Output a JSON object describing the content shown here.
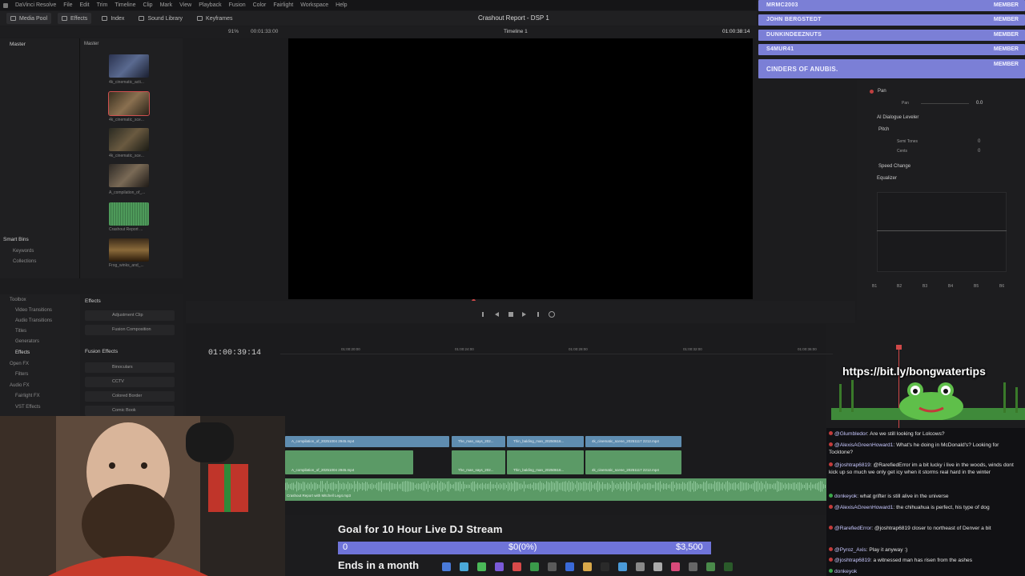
{
  "app": {
    "menu": [
      "DaVinci Resolve",
      "File",
      "Edit",
      "Trim",
      "Timeline",
      "Clip",
      "Mark",
      "View",
      "Playback",
      "Fusion",
      "Color",
      "Fairlight",
      "Workspace",
      "Help"
    ],
    "project_title": "Crashout Report - DSP 1",
    "toolbar": {
      "media_pool": "Media Pool",
      "effects": "Effects",
      "index": "Index",
      "sound_library": "Sound Library",
      "keyframes": "Keyframes"
    },
    "row2": {
      "zoom": "91%",
      "source_tc": "00:01:33:00",
      "timeline_name": "Timeline 1",
      "record_tc": "01:00:38:14"
    }
  },
  "media_pool": {
    "bin_root": "Master",
    "smart_bins_header": "Smart Bins",
    "smart_bins": [
      "Keywords",
      "Collections"
    ],
    "clips": [
      "4k_cinematic_acti...",
      "4k_cinematic_sce...",
      "4k_cinematic_sce...",
      "A_compilation_of_...",
      "Crashout Report ...",
      "Frog_winks_and_..."
    ]
  },
  "toolbox": {
    "items": [
      "Toolbox",
      "Video Transitions",
      "Audio Transitions",
      "Titles",
      "Generators",
      "Effects",
      "Open FX",
      "Filters",
      "Audio FX",
      "Fairlight FX",
      "VST Effects"
    ],
    "effects_header": "Effects",
    "effects_items": [
      "Adjustment Clip",
      "Fusion Composition"
    ],
    "fusion_header": "Fusion Effects",
    "fusion_items": [
      "Binoculars",
      "CCTV",
      "Colored Border",
      "Comic Book"
    ]
  },
  "timeline": {
    "timecode": "01:00:39:14",
    "ruler": [
      "01:00:20:00",
      "01:00:24:00",
      "01:00:28:00",
      "01:00:32:00",
      "01:00:36:00",
      "01:00:40:00"
    ],
    "video_clips": [
      "A_compilation_of_20251004 2945.mp4",
      "The_man_says_202...",
      "Thin_balding_man_20250616...",
      "4k_cinematic_scene_20251117 2212.mp4"
    ],
    "audio_clips": [
      "A_compilation_of_20251004 2945.mp4",
      "The_man_says_202...",
      "Thin_balding_man_20250616...",
      "4k_cinematic_scene_20251117 2212.mp4"
    ],
    "audio_track_label": "Crashout Report with Mitchell Leg4.mp3"
  },
  "members": [
    {
      "name": "MRMC2003",
      "badge": "MEMBER"
    },
    {
      "name": "JOHN BERGSTEDT",
      "badge": "MEMBER"
    },
    {
      "name": "DUNKINDEEZNUTS",
      "badge": "MEMBER"
    },
    {
      "name": "S4MUR41",
      "badge": "MEMBER"
    },
    {
      "name": "CINDERS OF ANUBIS.",
      "badge": "MEMBER"
    }
  ],
  "inspector": {
    "pan": "Pan",
    "pan_sub": "Pan",
    "pan_value": "0.0",
    "dialogue_leveler": "AI Dialogue Leveler",
    "pitch": "Pitch",
    "semitones": "Semi Tones",
    "cents": "Cents",
    "semitones_value": "0",
    "cents_value": "0",
    "speed_change": "Speed Change",
    "equalizer": "Equalizer",
    "eq_bands": [
      "B1",
      "B2",
      "B3",
      "B4",
      "B5",
      "B6"
    ]
  },
  "overlay": {
    "link": "https://bit.ly/bongwatertips"
  },
  "chat": [
    {
      "user": "@Glumbledor",
      "text": "Are we still looking for Lolcows?"
    },
    {
      "user": "@AlexisAGreenHoward1",
      "text": "What's he doing in McDonald's? Looking for Tocktone?"
    },
    {
      "user": "@joshtrap6819",
      "text": "@RarefiedError im a bit lucky i live in the woods, winds dont kick up so much we only get icy when it storms real hard in the winter"
    },
    {
      "user": "donkeyok",
      "text": "what grifter is still alive in the universe"
    },
    {
      "user": "@AlexisAGreenHoward1",
      "text": "the chihuahua is perfect, his type of dog"
    },
    {
      "user": "@RarefiedError",
      "text": "@joshtrap6819 closer to northeast of Denver a bit"
    },
    {
      "user": "@Pyroz_Axis",
      "text": "Play it anyway :)"
    },
    {
      "user": "@joshtrap6819",
      "text": "a witnessed man has risen from the ashes"
    },
    {
      "user": "donkeyok",
      "text": ""
    }
  ],
  "goal": {
    "title": "Goal for 10 Hour Live DJ Stream",
    "start": "0",
    "current": "$0(0%)",
    "target": "$3,500",
    "progress": 0,
    "ends": "Ends in a month"
  },
  "colors": {
    "member_bar": "#7b7fd6",
    "video_clip": "#5f8db0",
    "audio_clip": "#5b9a66",
    "goal_bar": "#6f74d9",
    "playhead": "#d04848"
  }
}
